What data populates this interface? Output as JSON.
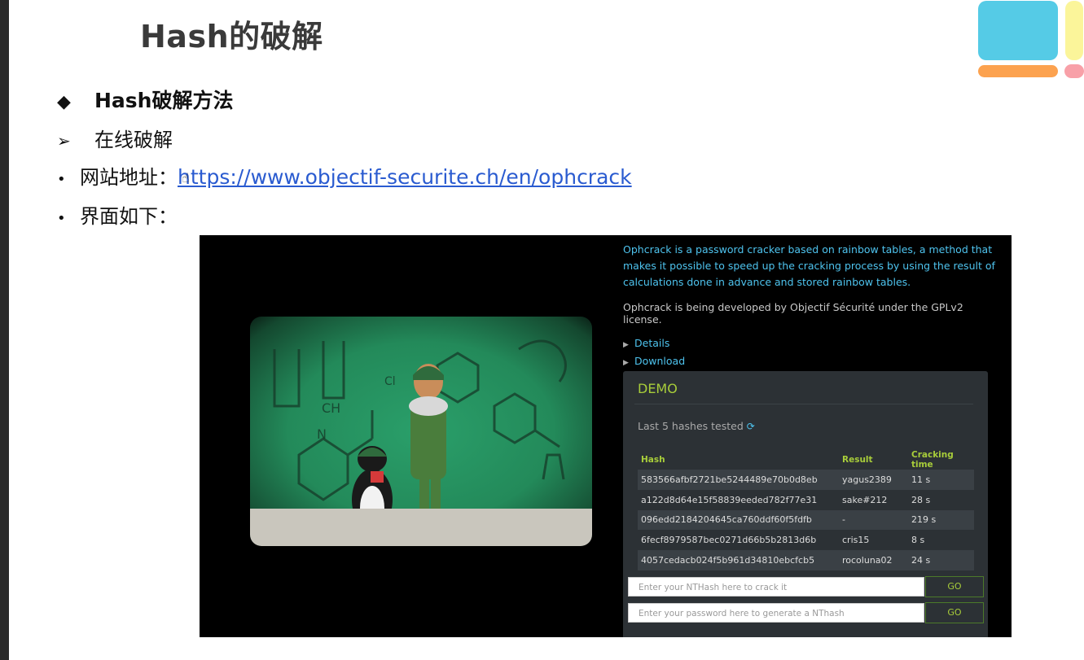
{
  "slide": {
    "title": "Hash的破解",
    "bullet1": {
      "mark": "◆",
      "text": "Hash破解方法"
    },
    "bullet2": {
      "mark": "➢",
      "text": "在线破解"
    },
    "bullet3": {
      "mark": "•",
      "label": "网站地址：",
      "link": "https://www.objectif-securite.ch/en/ophcrack"
    },
    "bullet4": {
      "mark": "•",
      "text": "界面如下："
    }
  },
  "ophcrack": {
    "description": "Ophcrack is a password cracker based on rainbow tables, a method that makes it possible to speed up the cracking process by using the result of calculations done in advance and stored rainbow tables.",
    "developer": "Ophcrack is being developed by Objectif Sécurité under the GPLv2 license.",
    "nav": [
      "Details",
      "Download"
    ],
    "demo": {
      "title": "DEMO",
      "subtitle": "Last 5 hashes tested",
      "refresh_icon": "refresh-icon",
      "columns": [
        "Hash",
        "Result",
        "Cracking time"
      ],
      "rows": [
        [
          "583566afbf2721be5244489e70b0d8eb",
          "yagus2389",
          "11 s"
        ],
        [
          "a122d8d64e15f58839eeded782f77e31",
          "sake#212",
          "28 s"
        ],
        [
          "096edd2184204645ca760ddf60f5fdfb",
          "-",
          "219 s"
        ],
        [
          "6fecf8979587bec0271d66b5b2813d6b",
          "cris15",
          "8 s"
        ],
        [
          "4057cedacb024f5b961d34810ebcfcb5",
          "rocoluna02",
          "24 s"
        ]
      ],
      "input1_placeholder": "Enter your NTHash here to crack it",
      "input2_placeholder": "Enter your password here to generate a NThash",
      "go_label": "GO"
    }
  },
  "colors": {
    "accent_green": "#a8cd3a",
    "link_blue": "#4ec3ee",
    "title_gray": "#3a3a3a"
  }
}
